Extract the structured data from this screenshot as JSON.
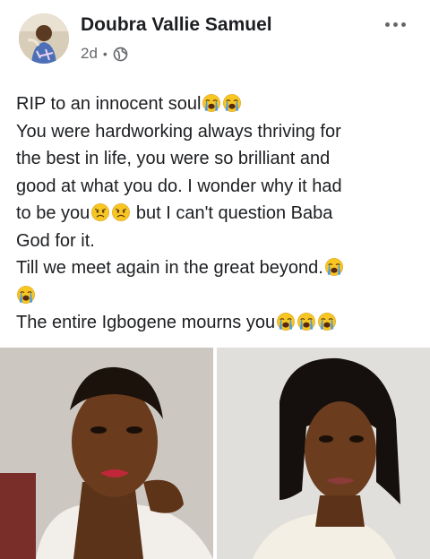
{
  "post": {
    "author": "Doubra Vallie Samuel",
    "time": "2d",
    "separator": "•",
    "privacy_icon": "globe-icon",
    "menu_icon": "more-horizontal-icon"
  },
  "text": {
    "l1": "RIP to an innocent soul",
    "l2": "You were hardworking always thriving for",
    "l3": "the best in life, you were so brilliant and",
    "l4": "good at what you do. I wonder why it had",
    "l5a": "to be you",
    "l5b": " but I can't question Baba",
    "l6": "God for it.",
    "l7": "Till we meet again in the great beyond.",
    "l9": "The entire Igbogene mourns you"
  },
  "emoji": {
    "crying": "loudly-crying-face-emoji",
    "frowning": "frowning-face-emoji"
  },
  "photos": [
    "portrait-photo-left",
    "portrait-photo-right"
  ],
  "colors": {
    "text": "#1c1e21",
    "secondary": "#65676b",
    "emoji_yellow": "#f7c623",
    "tears": "#4a9be3"
  }
}
